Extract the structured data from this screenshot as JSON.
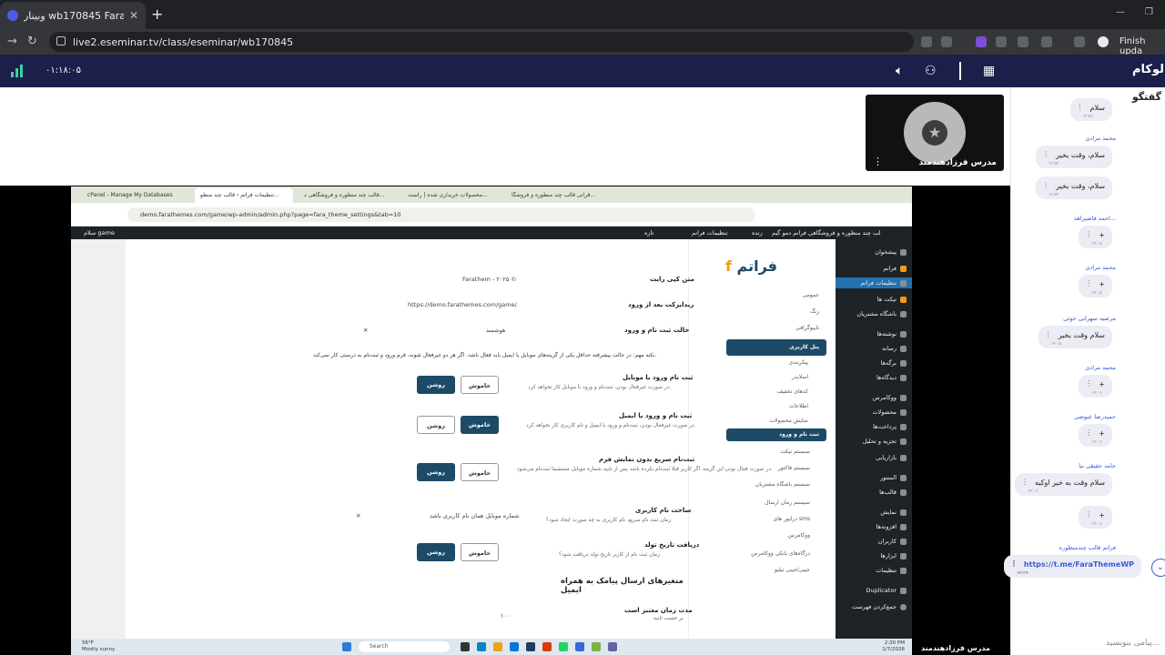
{
  "browser": {
    "tab_title": "وبینار wb170845 Farathe...",
    "url": "live2.eseminar.tv/class/eseminar/wb170845",
    "profile_action": "Finish upda"
  },
  "app": {
    "timer": "۰۱:۱۸:۰۵",
    "brand": "الوکام",
    "accent": "#1c1f4a"
  },
  "camera": {
    "presenter_name": "مدرس فرزادهندمند"
  },
  "share_label": "مدرس فرزادهندمند",
  "inner_browser": {
    "tabs": [
      "cPanel - Manage My Databases",
      "تنظیمات فراتم ‹ قالب چند منظو...",
      "قالب چند منظوره و فروشگاهی د...",
      "محصولات خریداری شده | راست...",
      "قرانی قالب چند منظوره و فروشگا..."
    ],
    "url": "demo.farathemes.com/game/wp-admin/admin.php?page=fara_theme_settings&tab=10"
  },
  "wp_toolbar": {
    "site": "قالب چند منظوره و فروشگاهی فراتم دمو گیم",
    "live": "زنده",
    "settings": "تنظیمات فراتم",
    "new": "تازه",
    "greeting": "سلام game"
  },
  "wp_menu": [
    "پیشخوان",
    "فراتم",
    "تنظیمات فراتم",
    "تیکت ها",
    "باشگاه مشتریان",
    "نوشته‌ها",
    "رسانه",
    "برگه‌ها",
    "دیدگاه‌ها",
    "ووکامرس",
    "محصولات",
    "پرداخت‌ها",
    "تجزیه و تحلیل",
    "بازاریابی",
    "المنتور",
    "قالب‌ها",
    "نمایش",
    "افزونه‌ها",
    "کاربران",
    "ابزارها",
    "تنظیمات",
    "Duplicator",
    "جمع‌کردن فهرست"
  ],
  "settings_nav": {
    "logo": "فراتم",
    "items": [
      "عمومی",
      "رنگ",
      "تایپوگرافی"
    ],
    "user_panel": "پنل کاربری",
    "sub_items": [
      "پیکربندی",
      "اسلایدر",
      "کدهای تخفیف",
      "اطلاعات",
      "نمایش محصولات"
    ],
    "active_sub": "ثبت نام و ورود",
    "more": [
      "سیستم تیکت",
      "سیستم فاکتور",
      "سیستم باشگاه مشتریان",
      "سیستم زمان ارسال",
      "درایور های sms",
      "ووکامرس",
      "درگاه‌های بانکی ووکامرس",
      "جیبی/جیبی تیلیو"
    ]
  },
  "settings": {
    "copyright_label": "متن کپی رایت",
    "copyright_value": "Farathem - ۲۰۲۵ ©",
    "redirect_label": "ریدایرکت بعد از ورود",
    "redirect_value": "https://demo.farathemes.com/game/",
    "mode_label": "حالت ثبت نام و ورود",
    "mode_value": "هوشمند",
    "note": "نکته مهم: در حالت پیشرفته حداقل یکی از گزینه‌های موبایل یا ایمیل باید فعال باشد. اگر هر دو غیرفعال شوند، فرم ورود و ثبت‌نام به درستی کار نمی‌کند.",
    "mobile_label": "ثبت نام ورود با موبایل",
    "mobile_help": "در صورت غیرفعال بودن، ثبت‌نام و ورود با موبایل کار نخواهد کرد.",
    "email_label": "ثبت نام و ورود با ایمیل",
    "email_help": "در صورت غیرفعال بودن، ثبت‌نام و ورود با ایمیل و نام کاربری کار نخواهد کرد.",
    "quick_label": "ثبت‌نام سریع بدون نمایش فرم",
    "quick_help": "در صورت فعال بودن این گزینه، اگر کاربر قبلا ثبت‌نام نکرده باشد پس از تایید شماره موبایل مستقیما ثبت‌نام می‌شود.",
    "username_label": "ساخت نام کاربری",
    "username_value": "شماره موبایل همان نام کاربری باشد",
    "username_help": "زمان ثبت نام سریع، نام کاربری به چه صورت ایجاد شود؟",
    "birthday_label": "دریافت تاریخ تولد",
    "birthday_help": "زمان ثبت نام از کاربر تاریخ تولد دریافت شود؟",
    "section_title": "متغیرهای ارسال پیامک به همراه ایمیل",
    "validity_label": "مدت زمان معتبر است",
    "validity_value": "۱۰۰",
    "validity_help": "بر حسب ثانیه",
    "on": "روشن",
    "off": "خاموش"
  },
  "taskbar": {
    "weather_temp": "56°F",
    "weather_desc": "Mostly sunny",
    "search": "Search",
    "time": "2:30 PM",
    "date": "1/7/2026"
  },
  "chat": {
    "header": "گفتگو",
    "messages": [
      {
        "name": "",
        "text": "سلام"
      },
      {
        "name": "محمد مرادی",
        "text": "سلام، وقت بخیر"
      },
      {
        "name": "",
        "text": "سلام، وقت بخیر"
      },
      {
        "name": "احمد فاضیزاهد...",
        "text": "+"
      },
      {
        "name": "محمد مرادی",
        "text": "+"
      },
      {
        "name": "مرضیه سهرابی خوئی",
        "text": "سلام وقت بخیر"
      },
      {
        "name": "محمد مرادی",
        "text": "+"
      },
      {
        "name": "حمیدرضا عیوضی",
        "text": "+"
      },
      {
        "name": "حامد حقیقی نیا",
        "text": "سلام وقت به خیر اوکیه"
      },
      {
        "name": "",
        "text": "+"
      },
      {
        "name": "فراتم قالب چندمنظوره",
        "text": "https://t.me/FaraThemeWP"
      }
    ],
    "input_placeholder": "پیامی بنویسید..."
  }
}
